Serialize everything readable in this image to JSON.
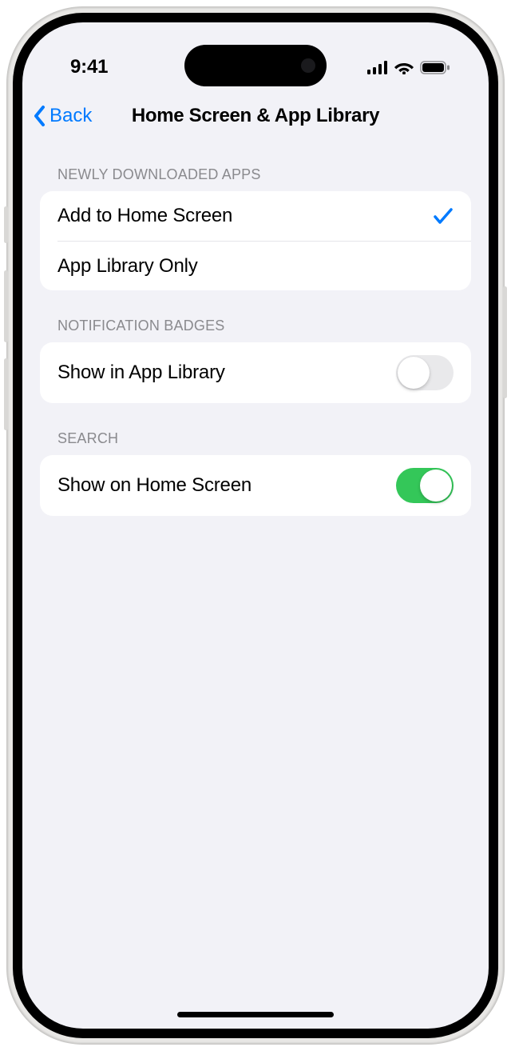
{
  "statusBar": {
    "time": "9:41"
  },
  "nav": {
    "back": "Back",
    "title": "Home Screen & App Library"
  },
  "sections": {
    "newlyDownloaded": {
      "header": "NEWLY DOWNLOADED APPS",
      "options": {
        "addToHome": {
          "label": "Add to Home Screen",
          "selected": true
        },
        "appLibraryOnly": {
          "label": "App Library Only",
          "selected": false
        }
      }
    },
    "notificationBadges": {
      "header": "NOTIFICATION BADGES",
      "row": {
        "label": "Show in App Library",
        "value": false
      }
    },
    "search": {
      "header": "SEARCH",
      "row": {
        "label": "Show on Home Screen",
        "value": true
      }
    }
  }
}
